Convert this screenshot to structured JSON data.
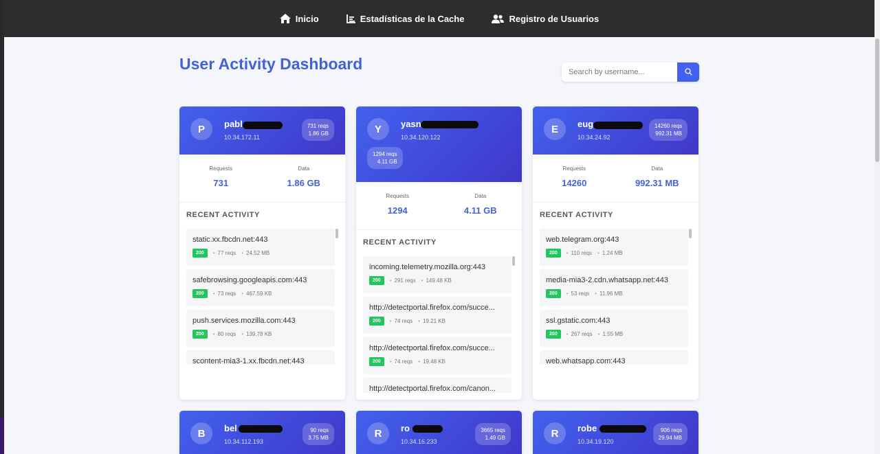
{
  "nav": {
    "home": "Inicio",
    "cache": "Estadísticas de la Cache",
    "users": "Registro de Usuarios"
  },
  "title": "User Activity Dashboard",
  "search": {
    "placeholder": "Search by username..."
  },
  "labels": {
    "requests": "Requests",
    "data": "Data",
    "recent": "RECENT ACTIVITY"
  },
  "cards": [
    {
      "initial": "P",
      "name": "pabl",
      "ip": "10.34.172.11",
      "badge_reqs": "731 reqs",
      "badge_data": "1.86 GB",
      "requests": "731",
      "data": "1.86 GB",
      "activity": [
        {
          "domain": "static.xx.fbcdn.net:443",
          "status": "200",
          "reqs": "77 reqs",
          "size": "24.52 MB"
        },
        {
          "domain": "safebrowsing.googleapis.com:443",
          "status": "200",
          "reqs": "73 reqs",
          "size": "467.59 KB"
        },
        {
          "domain": "push.services.mozilla.com:443",
          "status": "200",
          "reqs": "80 reqs",
          "size": "139.78 KB"
        },
        {
          "domain": "scontent-mia3-1.xx.fbcdn.net:443"
        }
      ]
    },
    {
      "initial": "Y",
      "name": "yasn",
      "ip": "10.34.120.122",
      "badge_reqs": "1294 reqs",
      "badge_data": "4.11 GB",
      "requests": "1294",
      "data": "4.11 GB",
      "activity": [
        {
          "domain": "incoming.telemetry.mozilla.org:443",
          "status": "200",
          "reqs": "291 reqs",
          "size": "149.48 KB"
        },
        {
          "domain": "http://detectportal.firefox.com/succe...",
          "status": "200",
          "reqs": "74 reqs",
          "size": "19.21 KB"
        },
        {
          "domain": "http://detectportal.firefox.com/succe...",
          "status": "200",
          "reqs": "74 reqs",
          "size": "19.48 KB"
        },
        {
          "domain": "http://detectportal.firefox.com/canon..."
        }
      ]
    },
    {
      "initial": "E",
      "name": "eug",
      "ip": "10.34.24.92",
      "badge_reqs": "14260 reqs",
      "badge_data": "992.31 MB",
      "requests": "14260",
      "data": "992.31 MB",
      "activity": [
        {
          "domain": "web.telegram.org:443",
          "status": "200",
          "reqs": "110 reqs",
          "size": "1.24 MB"
        },
        {
          "domain": "media-mia3-2.cdn.whatsapp.net:443",
          "status": "200",
          "reqs": "53 reqs",
          "size": "11.96 MB"
        },
        {
          "domain": "ssl.gstatic.com:443",
          "status": "200",
          "reqs": "267 reqs",
          "size": "1.55 MB"
        },
        {
          "domain": "web.whatsapp.com:443"
        }
      ]
    },
    {
      "initial": "B",
      "name": "bel",
      "ip": "10.34.112.193",
      "badge_reqs": "90 reqs",
      "badge_data": "3.75 MB"
    },
    {
      "initial": "R",
      "name": "ro",
      "ip": "10.34.16.233",
      "badge_reqs": "3665 reqs",
      "badge_data": "1.49 GB"
    },
    {
      "initial": "R",
      "name": "robe",
      "ip": "10.34.19.120",
      "badge_reqs": "906 reqs",
      "badge_data": "29.94 MB"
    }
  ]
}
